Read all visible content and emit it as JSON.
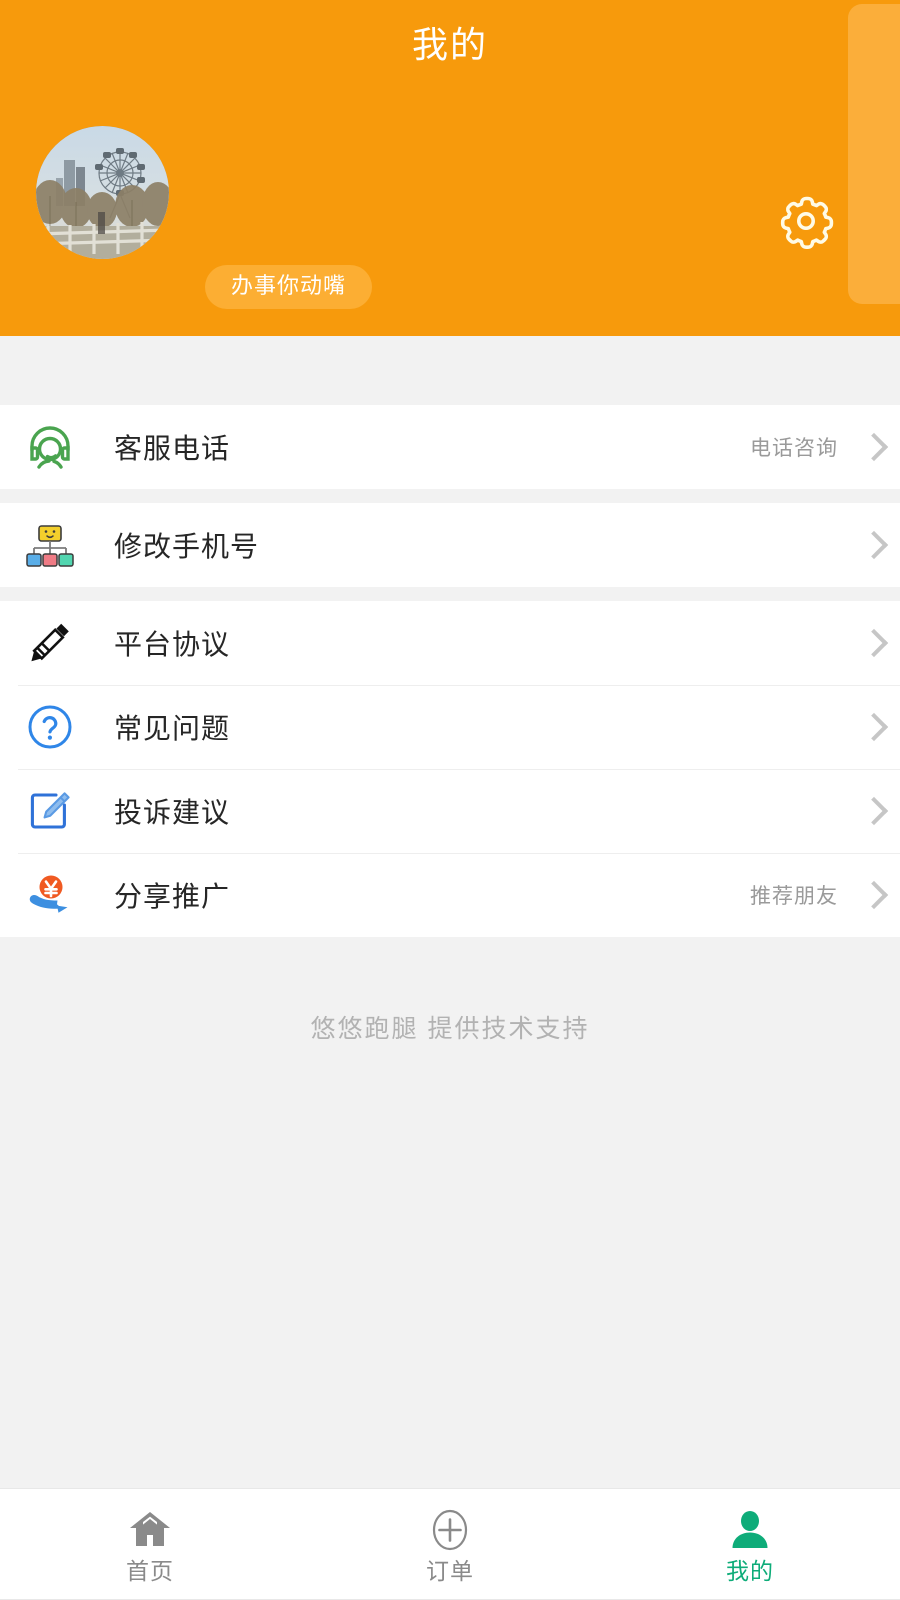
{
  "header": {
    "title": "我的",
    "nickname": "办事你动嘴",
    "settings_icon": "gear-icon",
    "avatar_icon": "avatar-ferris-wheel-photo",
    "bg_color": "#f79a0c",
    "badge_color": "#fcae33"
  },
  "menu_groups": [
    {
      "items": [
        {
          "icon": "customer-service-headset-icon",
          "label": "客服电话",
          "value": "电话咨询",
          "chevron": "chevron-right-icon"
        }
      ]
    },
    {
      "items": [
        {
          "icon": "org-chart-icon",
          "label": "修改手机号",
          "value": "",
          "chevron": "chevron-right-icon"
        }
      ]
    },
    {
      "items": [
        {
          "icon": "pencil-icon",
          "label": "平台协议",
          "value": "",
          "chevron": "chevron-right-icon"
        },
        {
          "icon": "question-circle-icon",
          "label": "常见问题",
          "value": "",
          "chevron": "chevron-right-icon"
        },
        {
          "icon": "edit-square-icon",
          "label": "投诉建议",
          "value": "",
          "chevron": "chevron-right-icon"
        },
        {
          "icon": "share-money-hand-icon",
          "label": "分享推广",
          "value": "推荐朋友",
          "chevron": "chevron-right-icon"
        }
      ]
    }
  ],
  "footer": {
    "note": "悠悠跑腿 提供技术支持"
  },
  "tabbar": {
    "active_color": "#0eac79",
    "inactive_color": "#8a8a8a",
    "tabs": [
      {
        "icon": "home-icon",
        "label": "首页",
        "active": false
      },
      {
        "icon": "plus-circle-icon",
        "label": "订单",
        "active": false
      },
      {
        "icon": "person-icon",
        "label": "我的",
        "active": true
      }
    ]
  }
}
